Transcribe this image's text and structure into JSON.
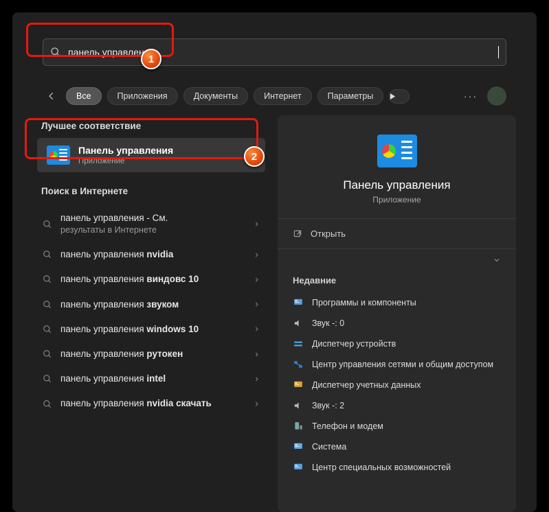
{
  "search": {
    "query": "панель управления"
  },
  "filters": {
    "all": "Все",
    "apps": "Приложения",
    "docs": "Документы",
    "web": "Интернет",
    "settings": "Параметры"
  },
  "sections": {
    "best_match": "Лучшее соответствие",
    "web_search": "Поиск в Интернете",
    "recent": "Недавние"
  },
  "best": {
    "title": "Панель управления",
    "subtitle": "Приложение"
  },
  "web_items": [
    {
      "prefix": "панель управления",
      "suffix": " - См.",
      "sub": "результаты в Интернете"
    },
    {
      "prefix": "панель управления ",
      "bold": "nvidia"
    },
    {
      "prefix": "панель управления ",
      "bold": "виндовс 10"
    },
    {
      "prefix": "панель управления ",
      "bold": "звуком"
    },
    {
      "prefix": "панель управления ",
      "bold": "windows 10"
    },
    {
      "prefix": "панель управления ",
      "bold": "рутокен"
    },
    {
      "prefix": "панель управления ",
      "bold": "intel"
    },
    {
      "prefix": "панель управления ",
      "bold": "nvidia скачать"
    }
  ],
  "preview": {
    "title": "Панель управления",
    "subtitle": "Приложение",
    "open": "Открыть"
  },
  "recent_items": [
    {
      "icon": "programs",
      "label": "Программы и компоненты"
    },
    {
      "icon": "sound",
      "label": "Звук -: 0"
    },
    {
      "icon": "devices",
      "label": "Диспетчер устройств"
    },
    {
      "icon": "network",
      "label": "Центр управления сетями и общим доступом"
    },
    {
      "icon": "credentials",
      "label": "Диспетчер учетных данных"
    },
    {
      "icon": "sound",
      "label": "Звук -: 2"
    },
    {
      "icon": "phone",
      "label": "Телефон и модем"
    },
    {
      "icon": "system",
      "label": "Система"
    },
    {
      "icon": "access",
      "label": "Центр специальных возможностей"
    }
  ],
  "markers": {
    "one": "1",
    "two": "2"
  }
}
